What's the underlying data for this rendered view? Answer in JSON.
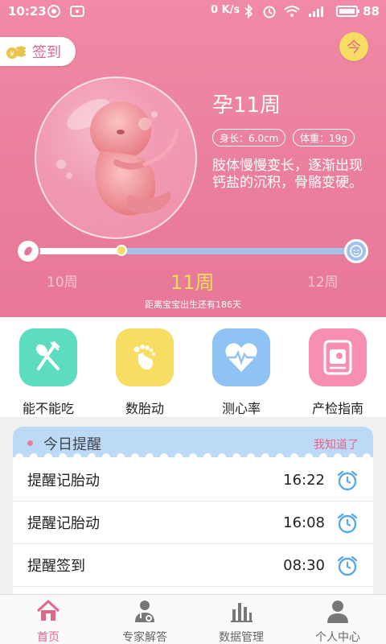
{
  "status_bar": {
    "time": "10:23",
    "speed": "0 K/s",
    "battery": "88"
  },
  "hero": {
    "checkin_label": "签到",
    "today_label": "今",
    "week_title": "孕11周",
    "length_label": "身长：6.0cm",
    "weight_label": "体重：19g",
    "description": "肢体慢慢变长，逐渐出现钙盐的沉积，骨骼变硬。",
    "progress": {
      "prev_week": "10周",
      "current_week": "11周",
      "next_week": "12周",
      "fraction": 0.33
    },
    "countdown": "距离宝宝出生还有186天"
  },
  "features": [
    {
      "label": "能不能吃",
      "icon": "fork-spoon-icon",
      "color": "#5ddcc0"
    },
    {
      "label": "数胎动",
      "icon": "footprint-icon",
      "color": "#f8dd63"
    },
    {
      "label": "测心率",
      "icon": "heart-rate-icon",
      "color": "#8fc3f4"
    },
    {
      "label": "产检指南",
      "icon": "ultrasound-icon",
      "color": "#f78fb3"
    }
  ],
  "reminders": {
    "title": "今日提醒",
    "ack_label": "我知道了",
    "items": [
      {
        "label": "提醒记胎动",
        "time": "16:22"
      },
      {
        "label": "提醒记胎动",
        "time": "16:08"
      },
      {
        "label": "提醒签到",
        "time": "08:30"
      }
    ]
  },
  "tabbar": {
    "items": [
      {
        "label": "首页",
        "icon": "home-icon",
        "active": true
      },
      {
        "label": "专家解答",
        "icon": "doctor-icon",
        "active": false
      },
      {
        "label": "数据管理",
        "icon": "bar-chart-icon",
        "active": false
      },
      {
        "label": "个人中心",
        "icon": "user-icon",
        "active": false
      }
    ]
  },
  "colors": {
    "brand_pink": "#ea7e9c",
    "accent_yellow": "#f8dd63",
    "progress_blue": "#a4c2e8"
  }
}
